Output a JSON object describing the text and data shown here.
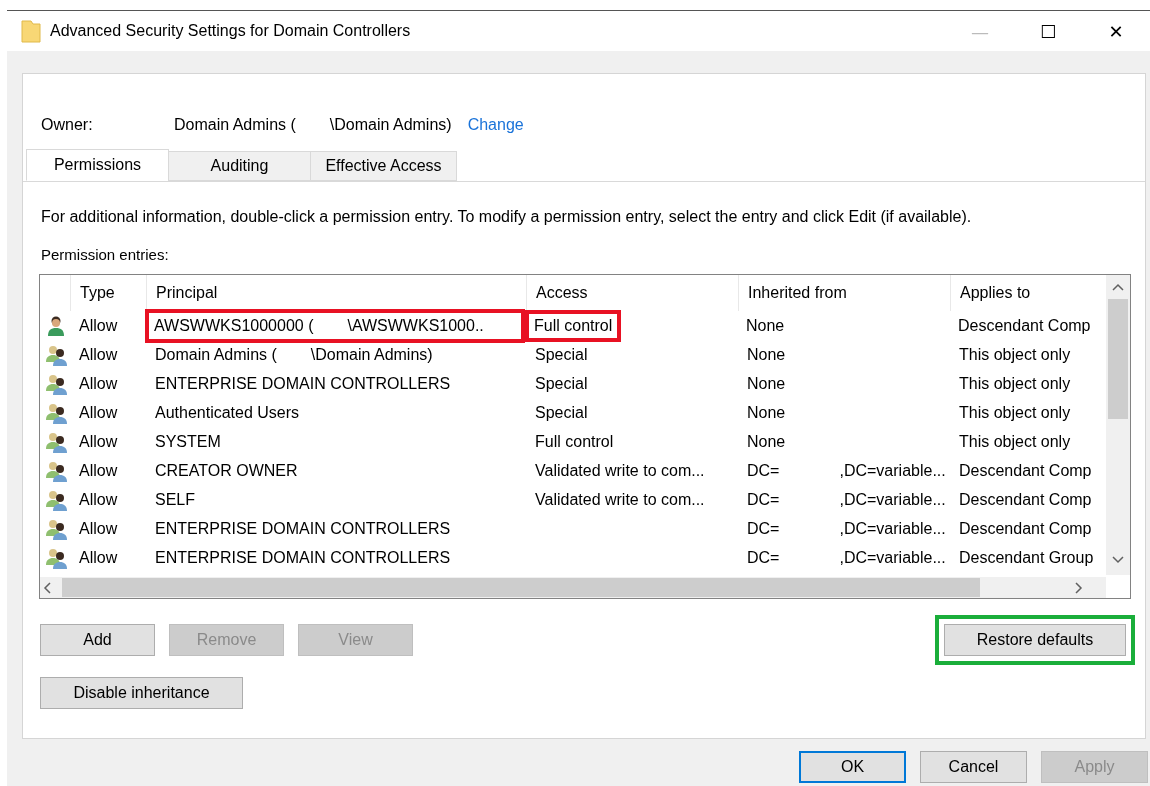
{
  "window": {
    "title": "Advanced Security Settings for Domain Controllers",
    "controls": [
      "—",
      "☐",
      "✕"
    ]
  },
  "owner": {
    "label": "Owner:",
    "value_parts": [
      "Domain Admins (",
      "\\Domain Admins)"
    ],
    "link": "Change"
  },
  "tabs": [
    {
      "label": "Permissions",
      "selected": true
    },
    {
      "label": "Auditing",
      "selected": false
    },
    {
      "label": "Effective Access",
      "selected": false
    }
  ],
  "info": "For additional information, double-click a permission entry. To modify a permission entry, select the entry and click Edit (if available).",
  "entries_label": "Permission entries:",
  "table": {
    "columns": [
      "Type",
      "Principal",
      "Access",
      "Inherited from",
      "Applies to"
    ],
    "rows": [
      {
        "kind": "user",
        "type": "Allow",
        "principal": [
          "AWSWWKS1000000 (",
          "\\AWSWWKS1000.."
        ],
        "access": "Full control",
        "inherited": [
          "None"
        ],
        "applies": "Descendant Comp",
        "annotated": true
      },
      {
        "kind": "group",
        "type": "Allow",
        "principal": [
          "Domain Admins (",
          "\\Domain Admins)"
        ],
        "access": "Special",
        "inherited": [
          "None"
        ],
        "applies": "This object only",
        "annotated": false
      },
      {
        "kind": "group",
        "type": "Allow",
        "principal": [
          "ENTERPRISE DOMAIN CONTROLLERS"
        ],
        "access": "Special",
        "inherited": [
          "None"
        ],
        "applies": "This object only",
        "annotated": false
      },
      {
        "kind": "group",
        "type": "Allow",
        "principal": [
          "Authenticated Users"
        ],
        "access": "Special",
        "inherited": [
          "None"
        ],
        "applies": "This object only",
        "annotated": false
      },
      {
        "kind": "group",
        "type": "Allow",
        "principal": [
          "SYSTEM"
        ],
        "access": "Full control",
        "inherited": [
          "None"
        ],
        "applies": "This object only",
        "annotated": false
      },
      {
        "kind": "group",
        "type": "Allow",
        "principal": [
          "CREATOR OWNER"
        ],
        "access": "Validated write to com...",
        "inherited": [
          "DC=",
          ",DC=variable..."
        ],
        "applies": "Descendant Comp",
        "annotated": false
      },
      {
        "kind": "group",
        "type": "Allow",
        "principal": [
          "SELF"
        ],
        "access": "Validated write to com...",
        "inherited": [
          "DC=",
          ",DC=variable..."
        ],
        "applies": "Descendant Comp",
        "annotated": false
      },
      {
        "kind": "group",
        "type": "Allow",
        "principal": [
          "ENTERPRISE DOMAIN CONTROLLERS"
        ],
        "inherited": [
          "DC=",
          ",DC=variable..."
        ],
        "applies": "Descendant Comp",
        "annotated": false
      },
      {
        "kind": "group",
        "type": "Allow",
        "principal": [
          "ENTERPRISE DOMAIN CONTROLLERS"
        ],
        "inherited": [
          "DC=",
          ",DC=variable..."
        ],
        "applies": "Descendant Group",
        "annotated": false
      }
    ]
  },
  "entry_buttons": [
    {
      "label": "Add",
      "disabled": false
    },
    {
      "label": "Remove",
      "disabled": true
    },
    {
      "label": "View",
      "disabled": true
    }
  ],
  "restore_button": {
    "label": "Restore defaults",
    "annotated": true
  },
  "inheritance_button": {
    "label": "Disable inheritance"
  },
  "dialog_buttons": [
    {
      "label": "OK",
      "disabled": false,
      "default": true
    },
    {
      "label": "Cancel",
      "disabled": false,
      "default": false
    },
    {
      "label": "Apply",
      "disabled": true,
      "default": false
    }
  ]
}
